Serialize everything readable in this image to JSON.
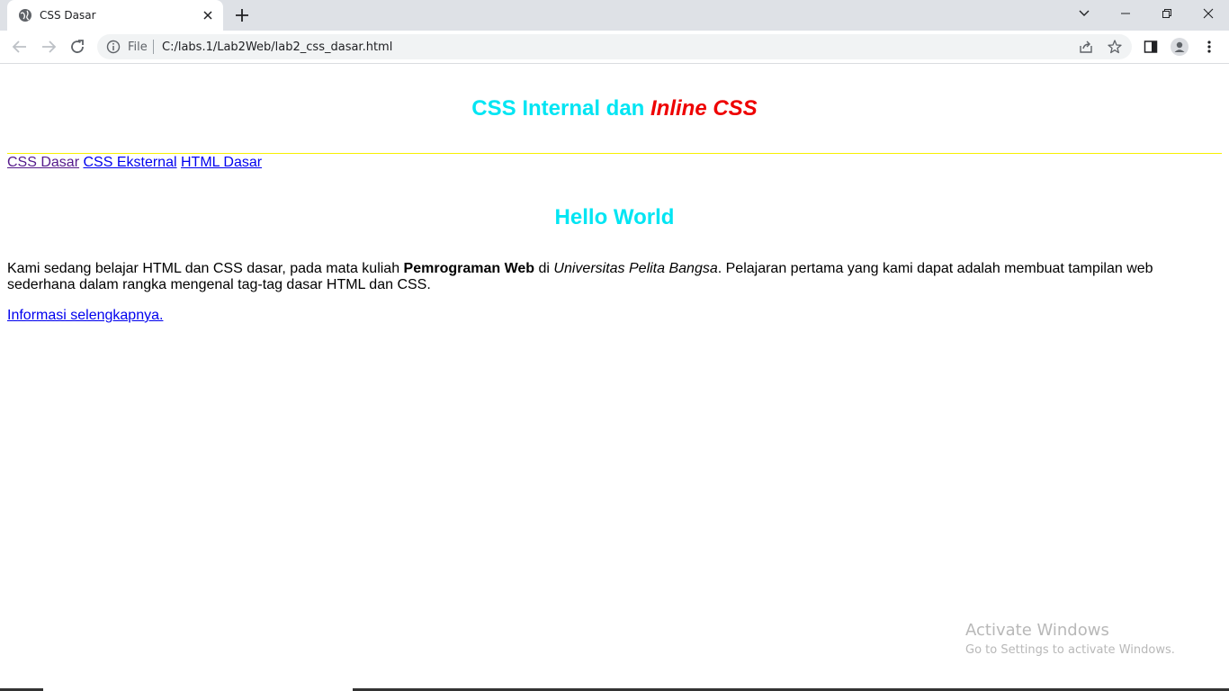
{
  "browser": {
    "tab": {
      "title": "CSS Dasar",
      "favicon": "globe-icon"
    },
    "omnibox": {
      "scheme_label": "File",
      "url": "C:/labs.1/Lab2Web/lab2_css_dasar.html"
    }
  },
  "page": {
    "heading1": {
      "part1": "CSS Internal dan ",
      "part2": "Inline CSS"
    },
    "nav": [
      {
        "label": "CSS Dasar"
      },
      {
        "label": "CSS Eksternal"
      },
      {
        "label": "HTML Dasar"
      }
    ],
    "heading2": "Hello World",
    "paragraph": {
      "t1": "Kami sedang belajar HTML dan CSS dasar, pada mata kuliah ",
      "bold": "Pemrograman Web",
      "t2": " di ",
      "italic": "Universitas Pelita Bangsa",
      "t3": ". Pelajaran pertama yang kami dapat adalah membuat tampilan web sederhana dalam rangka mengenal tag-tag dasar HTML dan CSS."
    },
    "more_link": "Informasi selengkapnya."
  },
  "watermark": {
    "line1": "Activate Windows",
    "line2": "Go to Settings to activate Windows."
  },
  "colors": {
    "heading": "#00e5f3",
    "inline": "#ee0000",
    "rule": "#f7f000",
    "link": "#0000ee",
    "visited": "#551a8b"
  }
}
